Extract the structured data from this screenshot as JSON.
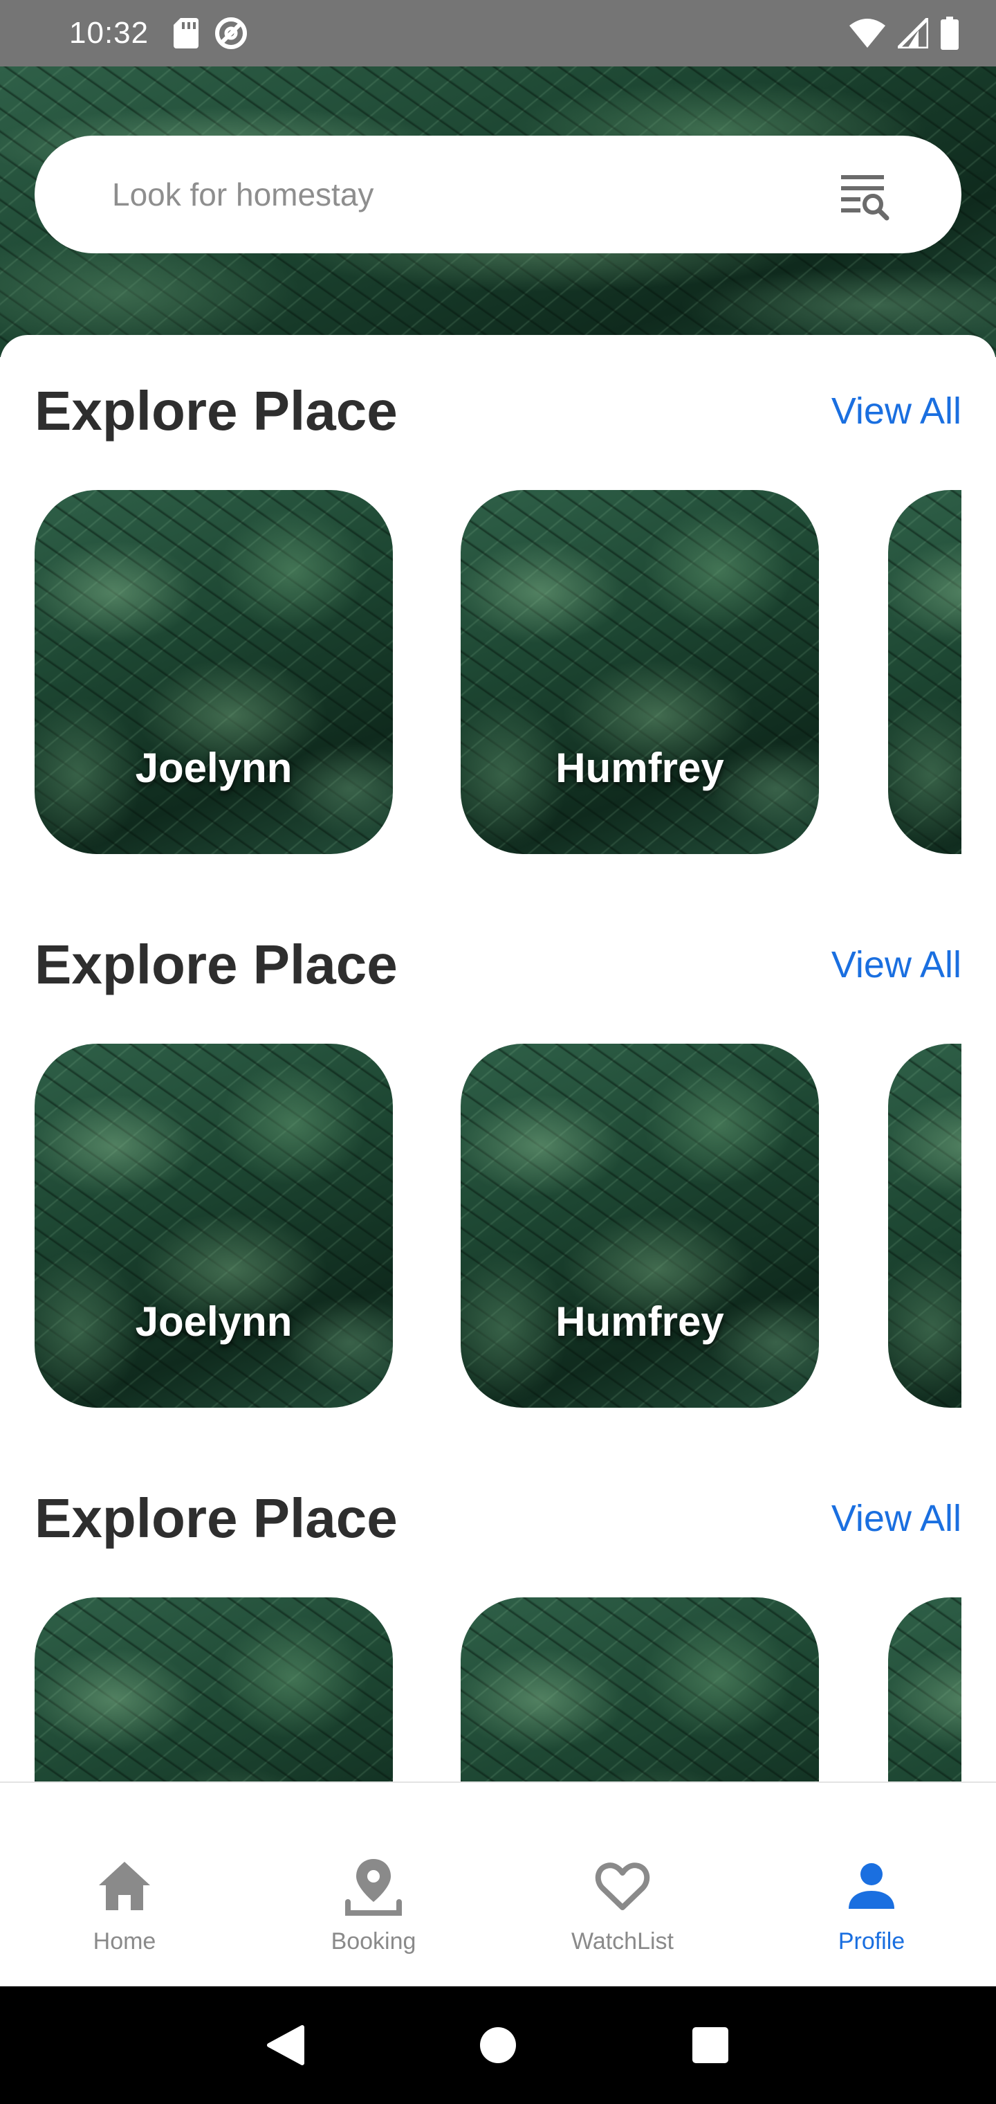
{
  "status_bar": {
    "time": "10:32",
    "left_icons": [
      "sd-card-icon",
      "at-sign-icon"
    ],
    "right_icons": [
      "wifi-icon",
      "cell-signal-icon",
      "battery-icon"
    ]
  },
  "search": {
    "placeholder": "Look for homestay",
    "filter_icon": "search-filter-icon"
  },
  "sections": [
    {
      "title": "Explore Place",
      "view_all_label": "View All",
      "cards": [
        {
          "label": "Joelynn"
        },
        {
          "label": "Humfrey"
        },
        {
          "label": ""
        }
      ]
    },
    {
      "title": "Explore Place",
      "view_all_label": "View All",
      "cards": [
        {
          "label": "Joelynn"
        },
        {
          "label": "Humfrey"
        },
        {
          "label": ""
        }
      ]
    },
    {
      "title": "Explore Place",
      "view_all_label": "View All",
      "cards": [
        {
          "label": ""
        },
        {
          "label": ""
        },
        {
          "label": ""
        }
      ]
    }
  ],
  "bottom_nav": {
    "items": [
      {
        "label": "Home",
        "icon": "home-icon",
        "active": false
      },
      {
        "label": "Booking",
        "icon": "location-pin-icon",
        "active": false
      },
      {
        "label": "WatchList",
        "icon": "heart-icon",
        "active": false
      },
      {
        "label": "Profile",
        "icon": "person-icon",
        "active": true
      }
    ]
  },
  "colors": {
    "accent": "#1a6fe0",
    "status_bar": "#757575",
    "nav_inactive": "#8a8a8a",
    "title_text": "#2e2e2e"
  }
}
